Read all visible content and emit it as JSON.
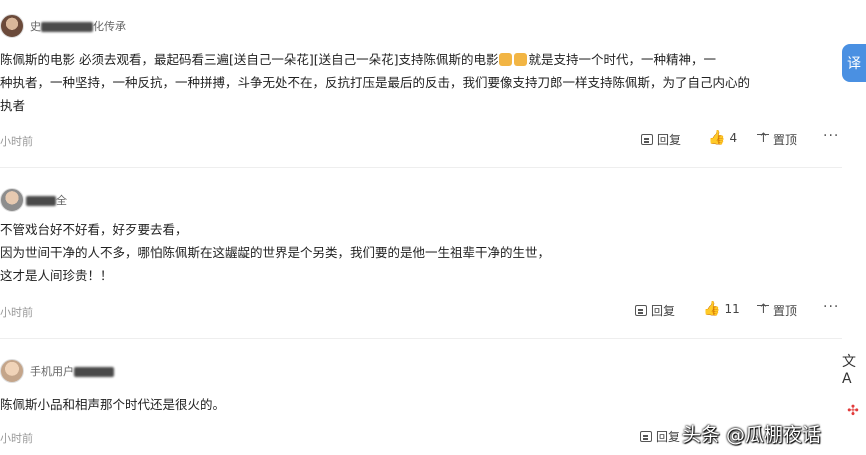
{
  "comments": [
    {
      "username_visible": "史",
      "username_suffix": "化传承",
      "lines": [
        "陈佩斯的电影          必须去观看，最起码看三遍[送自己一朵花][送自己一朵花]支持陈佩斯的电影",
        "就是支持一个时代，一种精神，一",
        "种执者，一种坚持，一种反抗，一种拼搏，斗争无处不在，反抗打压是最后的反击，我们要像支持刀郎一样支持陈佩斯，为了自己内心的",
        "执者"
      ],
      "time": "小时前",
      "reply_label": "回复",
      "like_count": "4",
      "top_label": "置顶",
      "more_label": "···"
    },
    {
      "username_visible": "",
      "username_suffix": "全",
      "lines": [
        "不管戏台好不好看，好歹要去看，",
        "因为世间干净的人不多，哪怕陈佩斯在这龌龊的世界是个另类，我们要的是他一生祖辈干净的生世，",
        "这才是人间珍贵！！"
      ],
      "time": "小时前",
      "reply_label": "回复",
      "like_count": "11",
      "top_label": "置顶",
      "more_label": "···"
    },
    {
      "username_visible": "手机用户",
      "username_suffix": "",
      "lines": [
        "陈佩斯小品和相声那个时代还是很火的。"
      ],
      "time": "小时前",
      "reply_label": "回复",
      "like_count": "",
      "top_label": "",
      "more_label": ""
    }
  ],
  "side": {
    "translate_label": "译",
    "icon_1": "translate-icon",
    "icon_2": "network-icon"
  },
  "watermark": "头条 @瓜棚夜话",
  "colors": {
    "like": "#f04142",
    "side_button": "#4a90e2",
    "muted_text": "#999999"
  }
}
